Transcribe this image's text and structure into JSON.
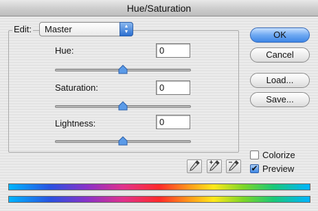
{
  "window": {
    "title": "Hue/Saturation"
  },
  "edit": {
    "label": "Edit:",
    "selected": "Master"
  },
  "sliders": [
    {
      "label": "Hue:",
      "value": "0",
      "position": 0.5
    },
    {
      "label": "Saturation:",
      "value": "0",
      "position": 0.5
    },
    {
      "label": "Lightness:",
      "value": "0",
      "position": 0.5
    }
  ],
  "buttons": {
    "ok": "OK",
    "cancel": "Cancel",
    "load": "Load...",
    "save": "Save..."
  },
  "options": {
    "colorize_label": "Colorize",
    "colorize_checked": false,
    "preview_label": "Preview",
    "preview_checked": true
  },
  "icons": [
    "eyedropper-icon",
    "eyedropper-plus-icon",
    "eyedropper-minus-icon"
  ],
  "colors": {
    "accent": "#3e86e6",
    "thumb": "#5b9be8"
  }
}
